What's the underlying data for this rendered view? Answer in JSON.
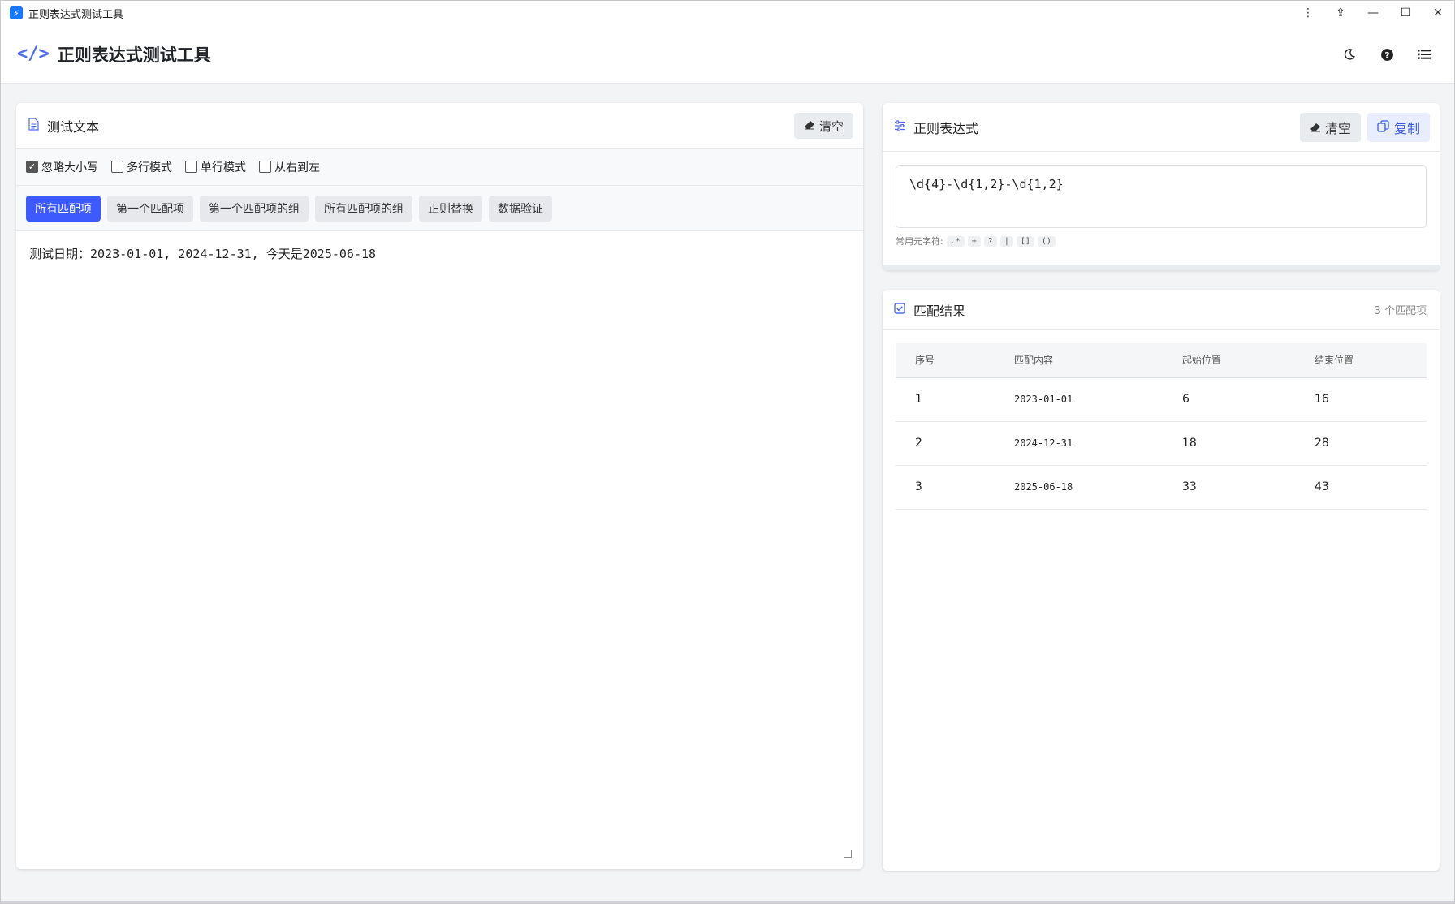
{
  "window": {
    "title": "正则表达式测试工具",
    "controls": [
      "⋮",
      "⇪",
      "—",
      "☐",
      "✕"
    ]
  },
  "header": {
    "icon": "</>",
    "title": "正则表达式测试工具"
  },
  "test_panel": {
    "title": "测试文本",
    "clear_label": "清空",
    "options": [
      {
        "label": "忽略大小写",
        "checked": true
      },
      {
        "label": "多行模式",
        "checked": false
      },
      {
        "label": "单行模式",
        "checked": false
      },
      {
        "label": "从右到左",
        "checked": false
      }
    ],
    "tabs": [
      "所有匹配项",
      "第一个匹配项",
      "第一个匹配项的组",
      "所有匹配项的组",
      "正则替换",
      "数据验证"
    ],
    "active_tab": 0,
    "text": "测试日期：2023-01-01, 2024-12-31, 今天是2025-06-18"
  },
  "regex_panel": {
    "title": "正则表达式",
    "clear_label": "清空",
    "copy_label": "复制",
    "pattern": "\\d{4}-\\d{1,2}-\\d{1,2}",
    "meta_label": "常用元字符:",
    "meta_chars": [
      ".*",
      "+",
      "?",
      "|",
      "[]",
      "()"
    ]
  },
  "result_panel": {
    "title": "匹配结果",
    "count": "3 个匹配项",
    "columns": [
      "序号",
      "匹配内容",
      "起始位置",
      "结束位置"
    ],
    "rows": [
      [
        "1",
        "2023-01-01",
        "6",
        "16"
      ],
      [
        "2",
        "2024-12-31",
        "18",
        "28"
      ],
      [
        "3",
        "2025-06-18",
        "33",
        "43"
      ]
    ]
  },
  "colors": {
    "accent": "#3d5afe",
    "icon": "#4f6bed"
  }
}
